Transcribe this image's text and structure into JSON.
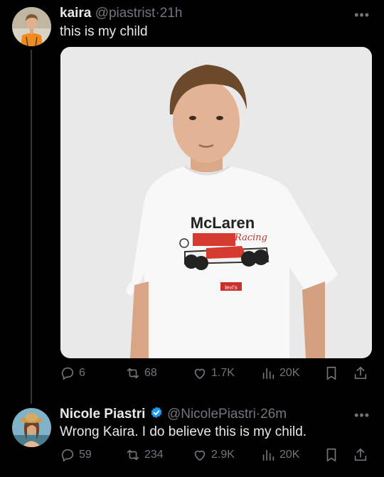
{
  "posts": [
    {
      "name": "kaira",
      "handle": "@piastrist",
      "dot": "·",
      "time": "21h",
      "text": "this is my child",
      "more": "•••",
      "avatar_icon": "user-avatar",
      "media": {
        "shirt_brand": "McLaren",
        "shirt_script": "Racing",
        "tag": "levi's"
      },
      "stats": {
        "replies": "6",
        "reposts": "68",
        "likes": "1.7K",
        "views": "20K"
      }
    },
    {
      "name": "Nicole Piastri",
      "handle": "@NicolePiastri",
      "dot": "·",
      "time": "26m",
      "text": "Wrong Kaira. I do believe this is my child.",
      "more": "•••",
      "verified": true,
      "avatar_icon": "user-avatar",
      "stats": {
        "replies": "59",
        "reposts": "234",
        "likes": "2.9K",
        "views": "20K"
      }
    }
  ],
  "colors": {
    "background": "#000000",
    "text": "#e7e9ea",
    "muted": "#71767b",
    "verified": "#1d9bf0"
  }
}
